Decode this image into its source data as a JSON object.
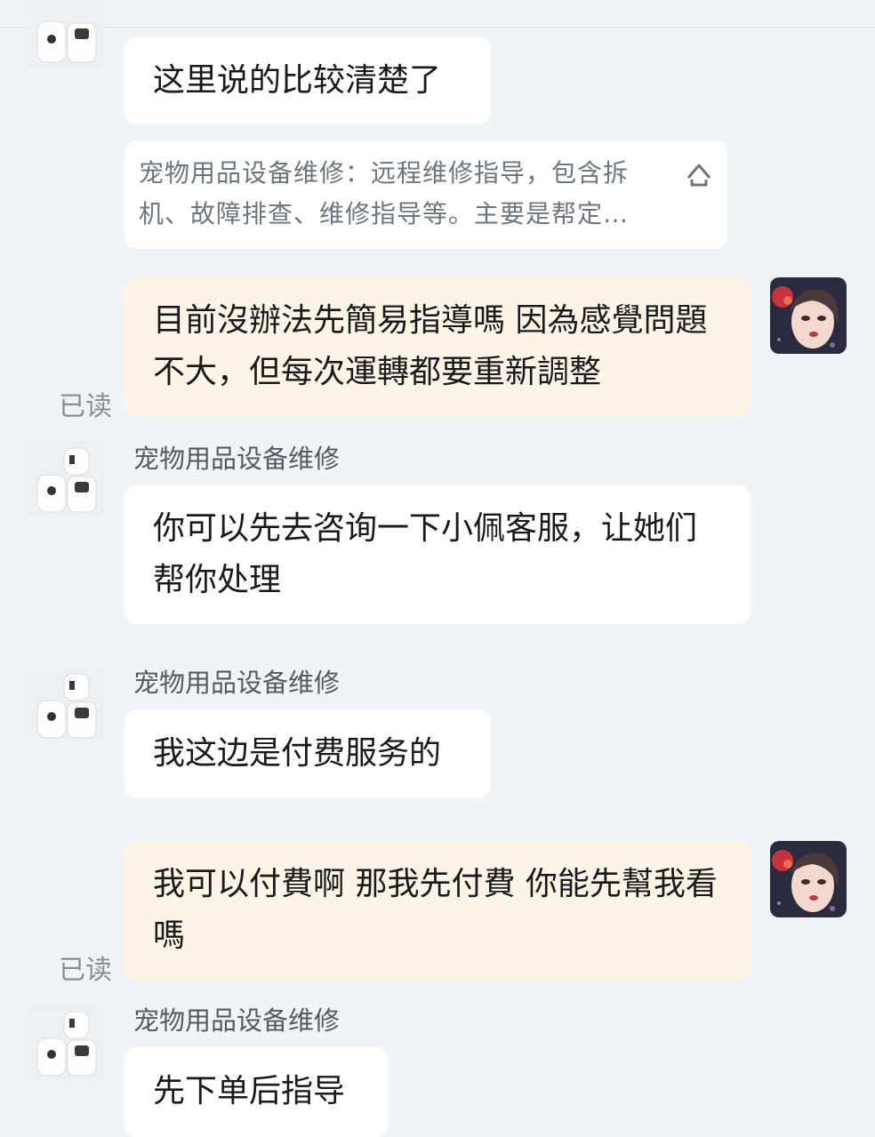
{
  "quote": {
    "text": "宠物用品设备维修：远程维修指导，包含拆机、故障排查、维修指导等。主要是帮定…",
    "icon": "expand-up-icon"
  },
  "messages": [
    {
      "role": "shop",
      "text": "这里说的比较清楚了"
    },
    {
      "role": "me",
      "text": "目前沒辦法先簡易指導嗎 因為感覺問題不大，但每次運轉都要重新調整",
      "status": "已读"
    },
    {
      "role": "shop",
      "sender": "宠物用品设备维修",
      "text": "你可以先去咨询一下小佩客服，让她们帮你处理"
    },
    {
      "role": "shop",
      "sender": "宠物用品设备维修",
      "text": "我这边是付费服务的"
    },
    {
      "role": "me",
      "text": "我可以付費啊 那我先付費 你能先幫我看嗎",
      "status": "已读"
    },
    {
      "role": "shop",
      "sender": "宠物用品设备维修",
      "text": "先下单后指导"
    }
  ],
  "colors": {
    "background": "#f1f4f7",
    "shop_bubble": "#ffffff",
    "my_bubble": "#fcf5e7",
    "read_status": "#8a8f96"
  }
}
